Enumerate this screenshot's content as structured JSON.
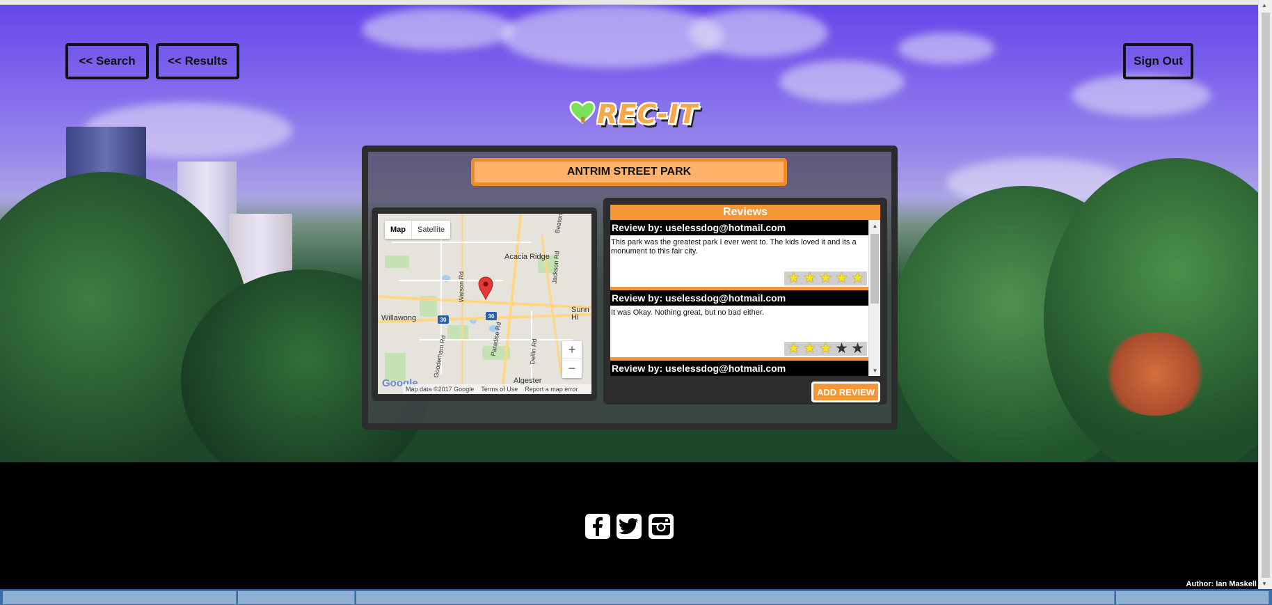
{
  "nav": {
    "search_label": "<< Search",
    "results_label": "<< Results",
    "signout_label": "Sign Out"
  },
  "logo": {
    "text": "REC-IT"
  },
  "park": {
    "name": "ANTRIM STREET PARK"
  },
  "map": {
    "type_options": [
      "Map",
      "Satellite"
    ],
    "selected_type": "Map",
    "labels": {
      "acacia_ridge": "Acacia Ridge",
      "willawong": "Willawong",
      "algester": "Algester",
      "sunnybank_hills": "Sunn\nHi",
      "watson_rd": "Watson Rd",
      "paradise_rd": "Paradise Rd",
      "goodernam_rd": "Gooderham Rd",
      "jackson_rd": "Jackson Rd",
      "beaton_rd": "Beaton Rd",
      "dewlin_rd": "Delfin Rd"
    },
    "route_shield": "30",
    "zoom_in": "+",
    "zoom_out": "−",
    "google_logo": "Google",
    "footer": [
      "Map data ©2017 Google",
      "Terms of Use",
      "Report a map error"
    ]
  },
  "reviews": {
    "heading": "Reviews",
    "items": [
      {
        "by": "Review by: uselessdog@hotmail.com",
        "text": "This park was the greatest park I ever went to. The kids loved it and its a monument to this fair city.",
        "rating": 5
      },
      {
        "by": "Review by: uselessdog@hotmail.com",
        "text": "It was Okay. Nothing great, but no bad either.",
        "rating": 3
      },
      {
        "by": "Review by: uselessdog@hotmail.com",
        "text": "",
        "rating": 0
      }
    ],
    "max_rating": 5,
    "add_label": "ADD REVIEW"
  },
  "footer": {
    "social": [
      "facebook",
      "twitter",
      "instagram"
    ],
    "author": "Author: Ian Maskell"
  },
  "colors": {
    "accent": "#f79636",
    "title_bg": "#ffb26a",
    "panel_border": "#2c2c2c",
    "star_on": "#f7e316"
  }
}
